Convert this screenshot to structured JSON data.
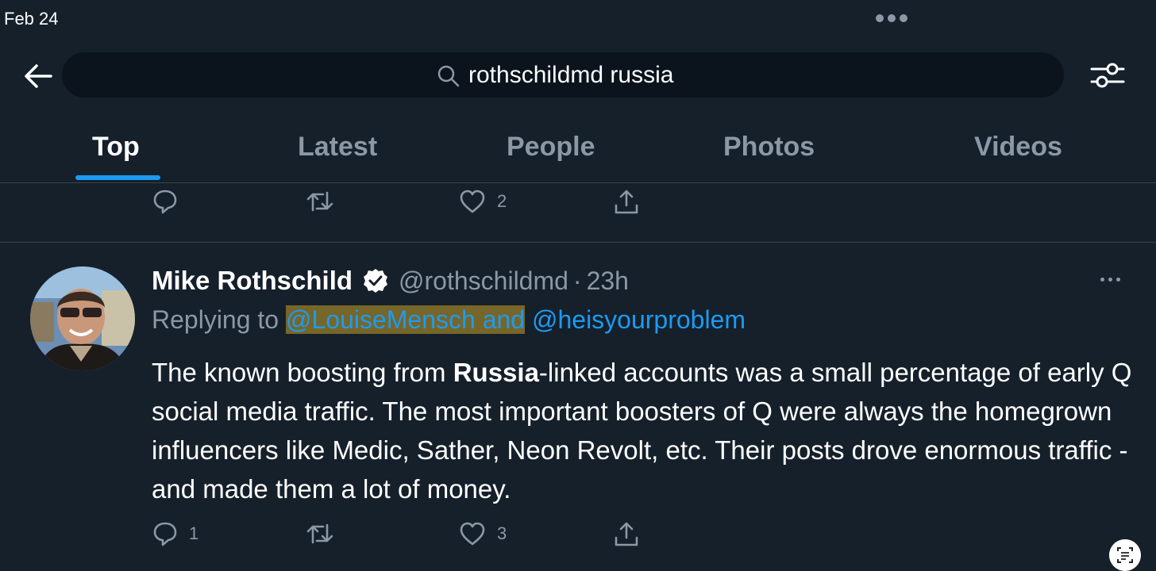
{
  "status_bar": {
    "date": "Feb 24"
  },
  "header": {
    "search": {
      "query": "rothschildmd russia"
    },
    "tabs": [
      {
        "label": "Top",
        "active": true
      },
      {
        "label": "Latest",
        "active": false
      },
      {
        "label": "People",
        "active": false
      },
      {
        "label": "Photos",
        "active": false
      },
      {
        "label": "Videos",
        "active": false
      }
    ]
  },
  "previous_tweet": {
    "actions": {
      "reply_count": "",
      "retweet_count": "",
      "like_count": "2"
    }
  },
  "tweet": {
    "author_name": "Mike Rothschild",
    "verified": true,
    "handle": "@rothschildmd",
    "separator": "·",
    "time": "23h",
    "replying_prefix": "Replying to",
    "replying_to_1": "@LouiseMensch and",
    "replying_to_2": "@heisyourproblem",
    "body_part1": "The known boosting from ",
    "body_bold": "Russia",
    "body_part2": "-linked accounts was a small percentage of early Q social media traffic. The most important boosters of Q were always the homegrown influencers like Medic, Sather, Neon Revolt, etc. Their posts drove enormous traffic - and made them a lot of money.",
    "actions": {
      "reply_count": "1",
      "retweet_count": "",
      "like_count": "3"
    }
  },
  "colors": {
    "background": "#15202b",
    "accent": "#1d9bf0",
    "secondary_text": "#8b98a5",
    "divider": "#38444d"
  },
  "icons": [
    "back-arrow-icon",
    "search-icon",
    "filter-sliders-icon",
    "reply-icon",
    "retweet-icon",
    "like-icon",
    "share-icon",
    "verified-badge-icon",
    "more-icon",
    "text-scan-icon"
  ]
}
